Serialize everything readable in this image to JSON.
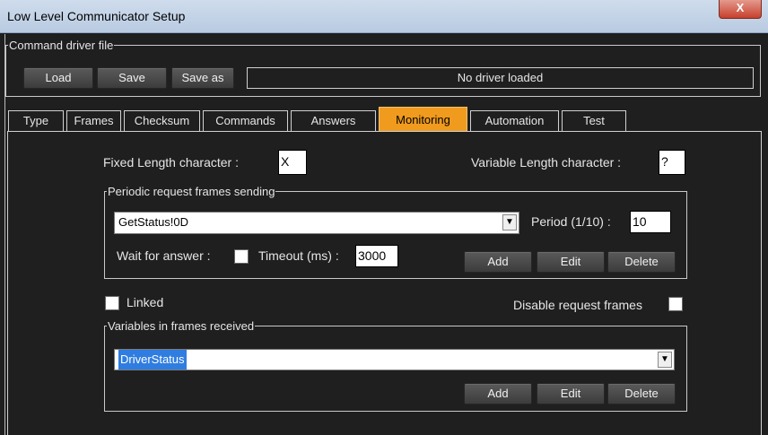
{
  "window": {
    "title": "Low Level Communicator Setup",
    "close_glyph": "X"
  },
  "driver_file": {
    "legend": "Command driver file",
    "load_label": "Load",
    "save_label": "Save",
    "save_as_label": "Save as",
    "status_text": "No driver loaded"
  },
  "tabs": [
    {
      "label": "Type"
    },
    {
      "label": "Frames"
    },
    {
      "label": "Checksum"
    },
    {
      "label": "Commands"
    },
    {
      "label": "Answers"
    },
    {
      "label": "Monitoring",
      "active": true
    },
    {
      "label": "Automation"
    },
    {
      "label": "Test"
    }
  ],
  "monitoring": {
    "fixed_length_label": "Fixed Length character :",
    "fixed_length_value": "X",
    "variable_length_label": "Variable Length character :",
    "variable_length_value": "?",
    "periodic": {
      "legend": "Periodic request frames sending",
      "frame_value": "GetStatus!0D",
      "period_label": "Period (1/10) :",
      "period_value": "10",
      "wait_label": "Wait for answer :",
      "timeout_label": "Timeout (ms) :",
      "timeout_value": "3000",
      "add_label": "Add",
      "edit_label": "Edit",
      "delete_label": "Delete"
    },
    "linked_label": "Linked",
    "disable_request_label": "Disable request frames",
    "variables": {
      "legend": "Variables in frames received",
      "selected_value": "DriverStatus",
      "add_label": "Add",
      "edit_label": "Edit",
      "delete_label": "Delete"
    }
  },
  "colors": {
    "active_tab": "#f09b1d",
    "selection": "#2f7de0",
    "background": "#1f1f1f"
  },
  "icons": {
    "dropdown": "chevron-down-icon",
    "close": "close-icon"
  }
}
